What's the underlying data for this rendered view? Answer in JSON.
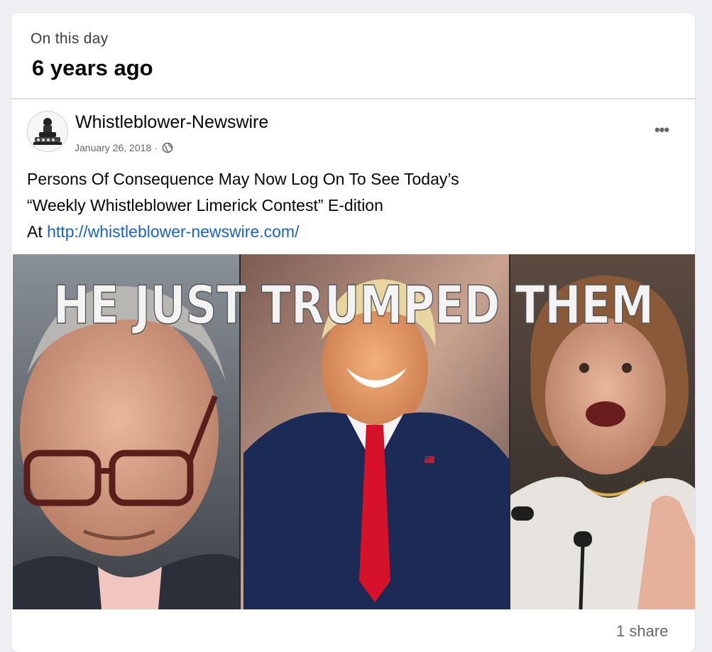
{
  "memory_header": {
    "subtitle": "On this day",
    "title": "6 years ago"
  },
  "post": {
    "page_name": "Whistleblower-Newswire",
    "date": "January 26, 2018",
    "date_separator": "·",
    "privacy_icon": "globe-icon",
    "more_label": "•••",
    "text_line1": "Persons Of Consequence May Now Log On To See Today’s",
    "text_line2": "“Weekly Whistleblower Limerick Contest” E-dition",
    "text_line3_prefix": "At ",
    "link": "http://whistleblower-newswire.com/",
    "image_caption": "HE JUST TRUMPED THEM",
    "share_count": "1 share"
  },
  "colors": {
    "background": "#eef0f4",
    "card": "#ffffff",
    "link": "#1a63c8",
    "muted": "#65676b",
    "tie": "#d5122a",
    "suit": "#1c2b55"
  }
}
